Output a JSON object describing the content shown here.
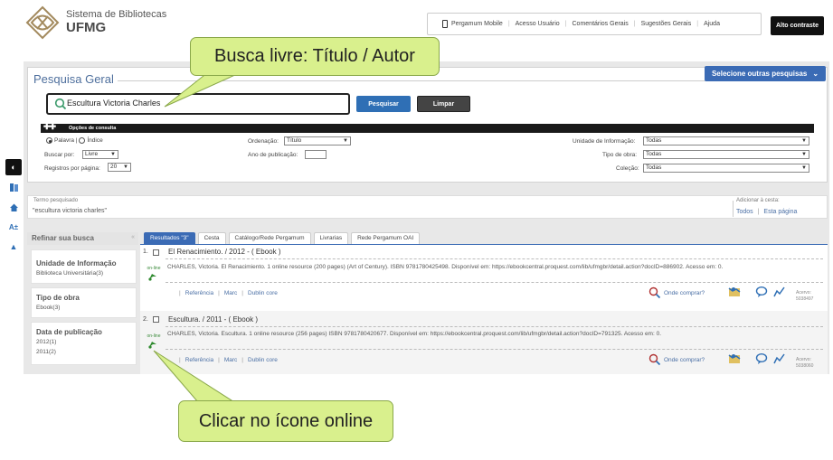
{
  "header": {
    "logo_line1": "Sistema de Bibliotecas",
    "logo_line2": "UFMG",
    "nav": [
      "Pergamum Mobile",
      "Acesso Usuário",
      "Comentários Gerais",
      "Sugestões Gerais",
      "Ajuda"
    ],
    "contrast_label": "Alto contraste"
  },
  "search": {
    "title": "Pesquisa Geral",
    "other_searches": "Selecione outras pesquisas",
    "query": "Escultura Victoria Charles",
    "search_button": "Pesquisar",
    "clear_button": "Limpar",
    "options_label": "Opções de consulta",
    "radio_word": "Palavra",
    "radio_index": "Índice",
    "buscar_por_label": "Buscar por:",
    "buscar_por_value": "Livre",
    "registros_label": "Registros por página:",
    "registros_value": "20",
    "ordenacao_label": "Ordenação:",
    "ordenacao_value": "Título",
    "ano_label": "Ano de publicação:",
    "unidade_label": "Unidade de Informação:",
    "unidade_value": "Todas",
    "tipo_label": "Tipo de obra:",
    "tipo_value": "Todas",
    "colecao_label": "Coleção:",
    "colecao_value": "Todas"
  },
  "term": {
    "label": "Termo pesquisado",
    "value": "\"escultura victoria charles\"",
    "basket_label": "Adicionar à cesta:",
    "basket_all": "Todos",
    "basket_page": "Esta página"
  },
  "refine": {
    "title": "Refinar sua busca",
    "facets": [
      {
        "title": "Unidade de Informação",
        "values": [
          "Biblioteca Universitária(3)"
        ]
      },
      {
        "title": "Tipo de obra",
        "values": [
          "Ebook(3)"
        ]
      },
      {
        "title": "Data de publicação",
        "values": [
          "2012(1)",
          "2011(2)"
        ]
      }
    ]
  },
  "tabs": [
    "Resultados \"3\"",
    "Cesta",
    "Catálogo/Rede Pergamum",
    "Livrarias",
    "Rede Pergamum OAI"
  ],
  "records": [
    {
      "num": "1.",
      "title": "El Renacimiento. / 2012 -  ( Ebook )",
      "desc": "CHARLES, Victoria. El Renacimiento. 1 online resource (200 pages) (Art of Century). ISBN 9781780425498. Disponível em: https://ebookcentral.proquest.com/lib/ufmgbr/detail.action?docID=886902. Acesso em: 0.",
      "online": "on-line",
      "links": [
        "Referência",
        "Marc",
        "Dublin core"
      ],
      "where": "Onde comprar?",
      "acervo_label": "Acervo:",
      "acervo": "5038497"
    },
    {
      "num": "2.",
      "title": "Escultura. / 2011 -  ( Ebook )",
      "desc": "CHARLES, Victoria. Escultura. 1 online resource (256 pages) ISBN 9781780420677. Disponível em: https://ebookcentral.proquest.com/lib/ufmgbr/detail.action?docID=791325. Acesso em: 0.",
      "online": "on-line",
      "links": [
        "Referência",
        "Marc",
        "Dublin core"
      ],
      "where": "Onde comprar?",
      "acervo_label": "Acervo:",
      "acervo": "5038060"
    }
  ],
  "callouts": {
    "top": "Busca livre: Título / Autor",
    "bottom": "Clicar no ícone online",
    "fill": "#d9f08d"
  },
  "colors": {
    "accent": "#3b6bb5",
    "link": "#4a6fa5"
  }
}
